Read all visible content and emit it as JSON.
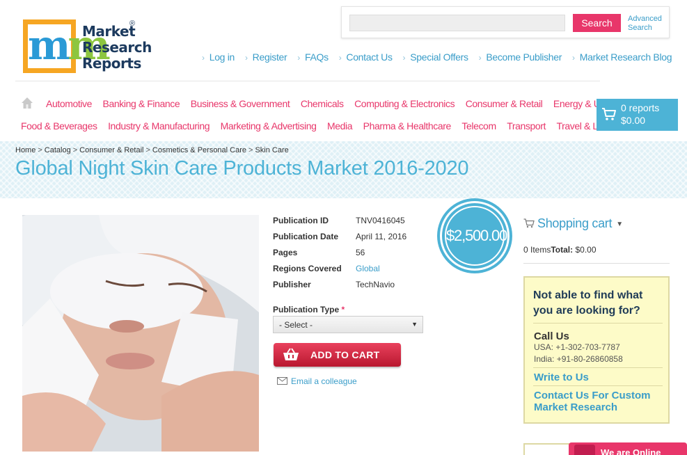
{
  "logo": {
    "line1": "Market",
    "line2": "Research",
    "line3": "Reports",
    "registered": "®"
  },
  "search": {
    "placeholder": "",
    "button_label": "Search",
    "advanced_line1": "Advanced",
    "advanced_line2": "Search"
  },
  "top_links": [
    "Log in",
    "Register",
    "FAQs",
    "Contact Us",
    "Special Offers",
    "Become Publisher",
    "Market Research Blog"
  ],
  "categories_row1": [
    "Automotive",
    "Banking & Finance",
    "Business & Government",
    "Chemicals",
    "Computing & Electronics",
    "Consumer & Retail",
    "Energy & Utilities"
  ],
  "categories_row2": [
    "Food & Beverages",
    "Industry & Manufacturing",
    "Marketing & Advertising",
    "Media",
    "Pharma & Healthcare",
    "Telecom",
    "Transport",
    "Travel & Leisure"
  ],
  "cart_summary": {
    "reports": "0 reports",
    "amount": "$0.00"
  },
  "breadcrumb": [
    "Home",
    "Catalog",
    "Consumer & Retail",
    "Cosmetics & Personal Care",
    "Skin Care"
  ],
  "breadcrumb_sep": ">",
  "page_title": "Global Night Skin Care Products Market 2016-2020",
  "product": {
    "details": [
      {
        "label": "Publication ID",
        "value": "TNV0416045",
        "link": false
      },
      {
        "label": "Publication Date",
        "value": "April 11, 2016",
        "link": false
      },
      {
        "label": "Pages",
        "value": "56",
        "link": false
      },
      {
        "label": "Regions Covered",
        "value": "Global",
        "link": true
      },
      {
        "label": "Publisher",
        "value": "TechNavio",
        "link": false
      }
    ],
    "publication_type_label": "Publication Type",
    "required_mark": "*",
    "select_value": "- Select -",
    "add_to_cart": "ADD TO CART",
    "email_colleague": "Email a colleague",
    "price": "$2,500.00"
  },
  "shopping_cart": {
    "title": "Shopping cart",
    "items_text": "0 Items",
    "total_label": "Total:",
    "total_value": "$0.00"
  },
  "help_box": {
    "question": "Not able to find what you are looking for?",
    "call_us": "Call Us",
    "usa": "USA: +1-302-703-7787",
    "india": "India: +91-80-26860858",
    "write_to_us": "Write to Us",
    "custom_research": "Contact Us For Custom Market Research"
  },
  "chat": {
    "label": "We are Online"
  },
  "colors": {
    "accent_blue": "#4db3d6",
    "link_blue": "#3a9dc9",
    "brand_pink": "#e8366a",
    "logo_orange": "#f6a623",
    "help_yellow": "#fdfbc8"
  },
  "icons": [
    "home-icon",
    "cart-icon",
    "basket-icon",
    "envelope-icon",
    "chat-icon",
    "chevron-down-icon"
  ]
}
